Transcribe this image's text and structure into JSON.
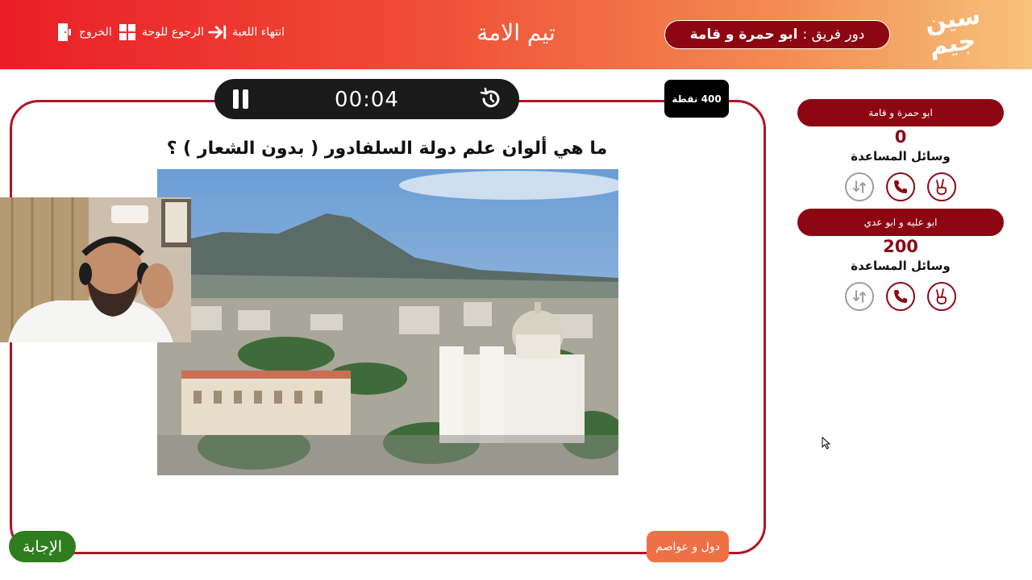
{
  "header": {
    "logo_line1": "سين",
    "logo_line2": "جيم",
    "turn_label": "دور فريق :",
    "turn_team": "ابو حمرة و قامة",
    "game_title": "تيم الامة",
    "nav": {
      "end_game": "انتهاء اللعبة",
      "back_to_board": "الرجوع للوحة",
      "exit": "الخروج"
    }
  },
  "timer": {
    "time": "00:04"
  },
  "points_badge": "400 نقطة",
  "question": "ما هي ألوان علم دولة السلفادور ( بدون الشعار ) ؟",
  "answer_button": "الإجابة",
  "category": "دول و عواصم",
  "teams": [
    {
      "name": "ابو حمرة و قامة",
      "score": "0",
      "aids_label": "وسائل المساعدة"
    },
    {
      "name": "ابو عليه و ابو عدي",
      "score": "200",
      "aids_label": "وسائل المساعدة"
    }
  ],
  "colors": {
    "accent_dark_red": "#8d0713",
    "card_border": "#b51224",
    "answer_green": "#2e7d1f",
    "category_orange": "#f07046"
  }
}
